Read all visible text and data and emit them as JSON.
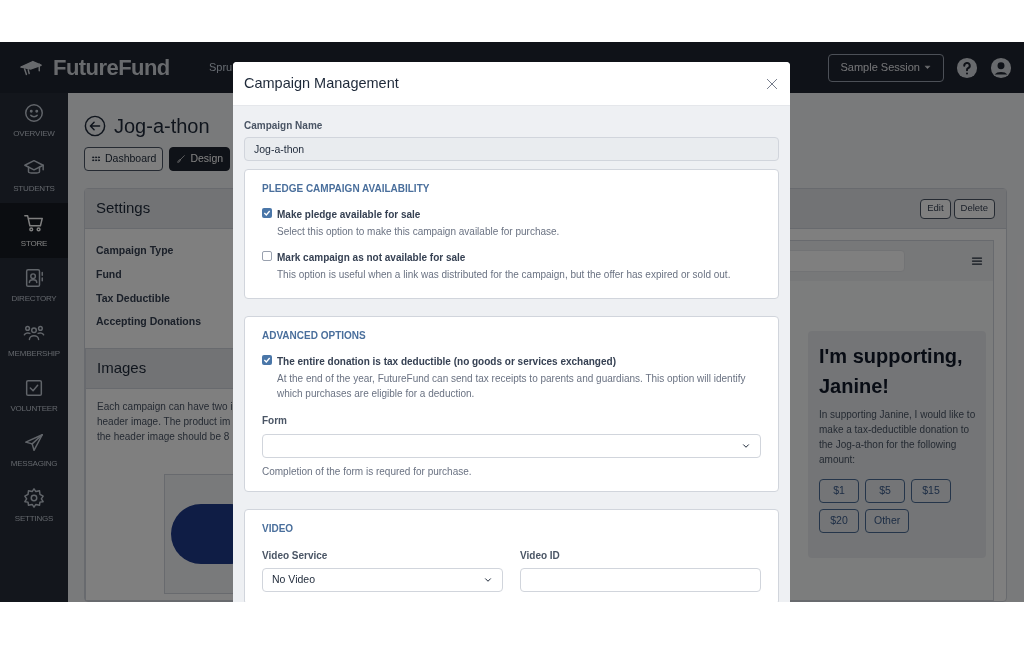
{
  "nav": {
    "brand": "FutureFund",
    "org": "Spru",
    "session_button": "Sample Session"
  },
  "sidebar": {
    "items": [
      {
        "label": "OVERVIEW",
        "selected": false
      },
      {
        "label": "STUDENTS",
        "selected": false
      },
      {
        "label": "STORE",
        "selected": true
      },
      {
        "label": "DIRECTORY",
        "selected": false
      },
      {
        "label": "MEMBERSHIP",
        "selected": false
      },
      {
        "label": "VOLUNTEER",
        "selected": false
      },
      {
        "label": "MESSAGING",
        "selected": false
      },
      {
        "label": "SETTINGS",
        "selected": false
      }
    ]
  },
  "page": {
    "title": "Jog-a-thon",
    "tabs": [
      {
        "label": "Dashboard",
        "selected": false
      },
      {
        "label": "Design",
        "selected": true
      }
    ]
  },
  "settings": {
    "title": "Settings",
    "buttons": [
      "Edit",
      "Delete"
    ],
    "fields": [
      "Campaign Type",
      "Fund",
      "Tax Deductible",
      "Accepting Donations"
    ]
  },
  "images": {
    "title": "Images",
    "lines": [
      "Each campaign can have two i",
      "header image. The product im",
      "the header image should be 8"
    ]
  },
  "preview": {
    "heading": "I'm supporting, Janine!",
    "body": "In supporting Janine, I would like to make a tax-deductible donation to the Jog-a-thon for the following amount:",
    "amounts": [
      "$1",
      "$5",
      "$15",
      "$20",
      "Other"
    ]
  },
  "modal": {
    "title": "Campaign Management",
    "campaign_name": {
      "label": "Campaign Name",
      "value": "Jog-a-thon"
    },
    "availability": {
      "heading": "PLEDGE CAMPAIGN AVAILABILITY",
      "options": [
        {
          "label": "Make pledge available for sale",
          "help": "Select this option to make this campaign available for purchase.",
          "checked": true
        },
        {
          "label": "Mark campaign as not available for sale",
          "help": "This option is useful when a link was distributed for the campaign, but the offer has expired or sold out.",
          "checked": false
        }
      ]
    },
    "advanced": {
      "heading": "ADVANCED OPTIONS",
      "options": [
        {
          "label": "The entire donation is tax deductible (no goods or services exchanged)",
          "help": "At the end of the year, FutureFund can send tax receipts to parents and guardians. This option will identify which purchases are eligible for a deduction.",
          "checked": true
        }
      ],
      "form": {
        "label": "Form",
        "help": "Completion of the form is requred for purchase."
      }
    },
    "video": {
      "heading": "VIDEO",
      "service": {
        "label": "Video Service",
        "value": "No Video"
      },
      "video_id": {
        "label": "Video ID"
      }
    }
  }
}
